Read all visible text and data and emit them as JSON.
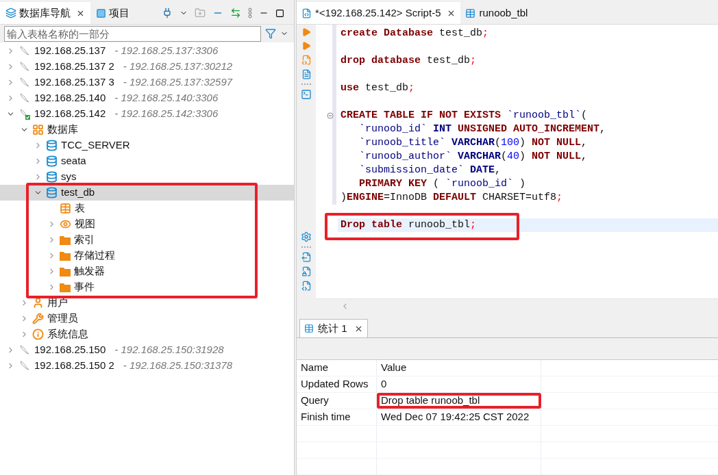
{
  "navigator": {
    "tabs": [
      {
        "label": "数据库导航",
        "selected": true
      },
      {
        "label": "项目",
        "selected": false
      }
    ],
    "filter": {
      "placeholder": "输入表格名称的一部分"
    },
    "tree": [
      {
        "kind": "connection",
        "label": "192.168.25.137",
        "detail": "- 192.168.25.137:3306",
        "expanded": false,
        "connected": false,
        "selected": false,
        "highlighted": false
      },
      {
        "kind": "connection",
        "label": "192.168.25.137 2",
        "detail": "- 192.168.25.137:30212",
        "expanded": false,
        "connected": false,
        "selected": false,
        "highlighted": false
      },
      {
        "kind": "connection",
        "label": "192.168.25.137 3",
        "detail": "- 192.168.25.137:32597",
        "expanded": false,
        "connected": false,
        "selected": false,
        "highlighted": false
      },
      {
        "kind": "connection",
        "label": "192.168.25.140",
        "detail": "- 192.168.25.140:3306",
        "expanded": false,
        "connected": false,
        "selected": false,
        "highlighted": false
      },
      {
        "kind": "connection",
        "label": "192.168.25.142",
        "detail": "- 192.168.25.142:3306",
        "expanded": true,
        "connected": true,
        "selected": false,
        "highlighted": false,
        "children": [
          {
            "kind": "databases",
            "label": "数据库",
            "expanded": true,
            "selected": false,
            "highlighted": false,
            "children": [
              {
                "kind": "database",
                "label": "TCC_SERVER",
                "expanded": false,
                "selected": false,
                "highlighted": false
              },
              {
                "kind": "database",
                "label": "seata",
                "expanded": false,
                "selected": false,
                "highlighted": false
              },
              {
                "kind": "database",
                "label": "sys",
                "expanded": false,
                "selected": false,
                "highlighted": false
              },
              {
                "kind": "database",
                "label": "test_db",
                "expanded": true,
                "selected": true,
                "highlighted": true,
                "children": [
                  {
                    "kind": "tables",
                    "label": "表",
                    "selected": false,
                    "highlighted": false
                  },
                  {
                    "kind": "views",
                    "label": "视图",
                    "expanded": false,
                    "selected": false,
                    "highlighted": false
                  },
                  {
                    "kind": "folder",
                    "label": "索引",
                    "expanded": false,
                    "selected": false,
                    "highlighted": false
                  },
                  {
                    "kind": "folder",
                    "label": "存储过程",
                    "expanded": false,
                    "selected": false,
                    "highlighted": false
                  },
                  {
                    "kind": "folder",
                    "label": "触发器",
                    "expanded": false,
                    "selected": false,
                    "highlighted": false
                  },
                  {
                    "kind": "folder",
                    "label": "事件",
                    "expanded": false,
                    "selected": false,
                    "highlighted": false
                  }
                ]
              }
            ]
          },
          {
            "kind": "users",
            "label": "用户",
            "expanded": false,
            "selected": false,
            "highlighted": false
          },
          {
            "kind": "admins",
            "label": "管理员",
            "expanded": false,
            "selected": false,
            "highlighted": false
          },
          {
            "kind": "info",
            "label": "系统信息",
            "expanded": false,
            "selected": false,
            "highlighted": false
          }
        ]
      },
      {
        "kind": "connection",
        "label": "192.168.25.150",
        "detail": "- 192.168.25.150:31928",
        "expanded": false,
        "connected": false,
        "selected": false,
        "highlighted": false
      },
      {
        "kind": "connection",
        "label": "192.168.25.150 2",
        "detail": "- 192.168.25.150:31378",
        "expanded": false,
        "connected": false,
        "selected": false,
        "highlighted": false
      }
    ]
  },
  "editor": {
    "tabs": [
      {
        "label": "*<192.168.25.142> Script-5",
        "kind": "script",
        "selected": true
      },
      {
        "label": "runoob_tbl",
        "kind": "table",
        "selected": false
      }
    ],
    "lines": [
      {
        "blank_before": false,
        "indented": false,
        "current": false,
        "highlighted": false,
        "tokens": [
          {
            "t": "create",
            "kind": "kw"
          },
          {
            "t": "Database",
            "kind": "kw"
          },
          {
            "t": "test_db",
            "kind": "plain"
          },
          {
            "t": ";",
            "kind": "punct",
            "glued": true
          }
        ]
      },
      {
        "blank_before": true,
        "indented": false,
        "current": false,
        "highlighted": false,
        "tokens": [
          {
            "t": "drop",
            "kind": "kw"
          },
          {
            "t": "database",
            "kind": "kw"
          },
          {
            "t": "test_db",
            "kind": "plain"
          },
          {
            "t": ";",
            "kind": "punct",
            "glued": true
          }
        ]
      },
      {
        "blank_before": true,
        "indented": false,
        "current": false,
        "highlighted": false,
        "tokens": [
          {
            "t": "use",
            "kind": "kw"
          },
          {
            "t": "test_db",
            "kind": "plain"
          },
          {
            "t": ";",
            "kind": "punct",
            "glued": true
          }
        ]
      },
      {
        "blank_before": true,
        "indented": false,
        "current": false,
        "highlighted": false,
        "fold": true,
        "tokens": [
          {
            "t": "CREATE TABLE IF NOT EXISTS",
            "kind": "kw"
          },
          {
            "t": "`runoob_tbl`",
            "kind": "id"
          },
          {
            "t": "(",
            "kind": "plain",
            "glued": true
          }
        ]
      },
      {
        "blank_before": false,
        "indented": true,
        "current": false,
        "highlighted": false,
        "tokens": [
          {
            "t": "`runoob_id`",
            "kind": "id"
          },
          {
            "t": "INT",
            "kind": "type"
          },
          {
            "t": "UNSIGNED AUTO_INCREMENT",
            "kind": "kw"
          },
          {
            "t": ",",
            "kind": "plain",
            "glued": true
          }
        ]
      },
      {
        "blank_before": false,
        "indented": true,
        "current": false,
        "highlighted": false,
        "tokens": [
          {
            "t": "`runoob_title`",
            "kind": "id"
          },
          {
            "t": "VARCHAR",
            "kind": "type"
          },
          {
            "t": "(",
            "kind": "plain",
            "glued": true
          },
          {
            "t": "100",
            "kind": "num",
            "glued": true
          },
          {
            "t": ")",
            "kind": "plain",
            "glued": true
          },
          {
            "t": "NOT NULL",
            "kind": "kw"
          },
          {
            "t": ",",
            "kind": "plain",
            "glued": true
          }
        ]
      },
      {
        "blank_before": false,
        "indented": true,
        "current": false,
        "highlighted": false,
        "tokens": [
          {
            "t": "`runoob_author`",
            "kind": "id"
          },
          {
            "t": "VARCHAR",
            "kind": "type"
          },
          {
            "t": "(",
            "kind": "plain",
            "glued": true
          },
          {
            "t": "40",
            "kind": "num",
            "glued": true
          },
          {
            "t": ")",
            "kind": "plain",
            "glued": true
          },
          {
            "t": "NOT NULL",
            "kind": "kw"
          },
          {
            "t": ",",
            "kind": "plain",
            "glued": true
          }
        ]
      },
      {
        "blank_before": false,
        "indented": true,
        "current": false,
        "highlighted": false,
        "tokens": [
          {
            "t": "`submission_date`",
            "kind": "id"
          },
          {
            "t": "DATE",
            "kind": "type"
          },
          {
            "t": ",",
            "kind": "plain",
            "glued": true
          }
        ]
      },
      {
        "blank_before": false,
        "indented": true,
        "current": false,
        "highlighted": false,
        "tokens": [
          {
            "t": "PRIMARY KEY",
            "kind": "kw"
          },
          {
            "t": "(",
            "kind": "plain"
          },
          {
            "t": "`runoob_id`",
            "kind": "id"
          },
          {
            "t": ")",
            "kind": "plain"
          }
        ]
      },
      {
        "blank_before": false,
        "indented": false,
        "current": false,
        "highlighted": false,
        "tokens": [
          {
            "t": ")",
            "kind": "plain"
          },
          {
            "t": "ENGINE",
            "kind": "kw",
            "glued": true
          },
          {
            "t": "=InnoDB",
            "kind": "plain",
            "glued": true
          },
          {
            "t": "DEFAULT",
            "kind": "kw"
          },
          {
            "t": "CHARSET=utf8",
            "kind": "plain"
          },
          {
            "t": ";",
            "kind": "punct",
            "glued": true
          }
        ]
      },
      {
        "blank_before": true,
        "indented": false,
        "current": true,
        "highlighted": true,
        "tokens": [
          {
            "t": "Drop table",
            "kind": "kw"
          },
          {
            "t": "runoob_tbl",
            "kind": "plain"
          },
          {
            "t": ";",
            "kind": "punct",
            "glued": true
          }
        ]
      }
    ]
  },
  "results": {
    "tabs": [
      {
        "label": "统计 1",
        "selected": true
      }
    ],
    "columns": [
      "Name",
      "Value"
    ],
    "rows": [
      {
        "name": "Updated Rows",
        "value": "0",
        "highlighted": false
      },
      {
        "name": "Query",
        "value": "Drop table runoob_tbl",
        "highlighted": true
      },
      {
        "name": "Finish time",
        "value": "Wed Dec 07 19:42:25 CST 2022",
        "highlighted": false
      }
    ]
  }
}
